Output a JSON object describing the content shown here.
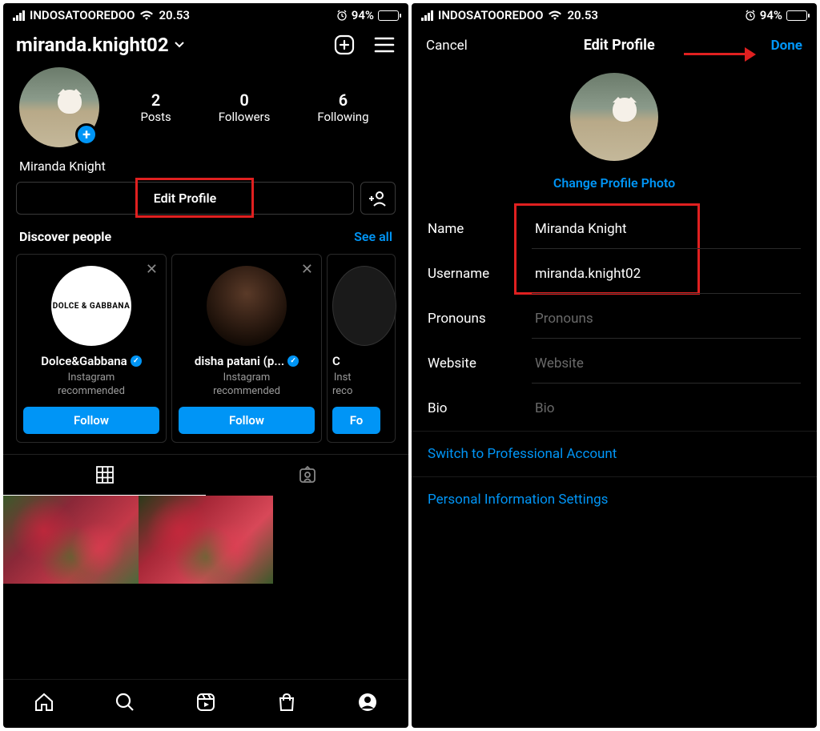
{
  "status": {
    "carrier": "INDOSATOOREDOO",
    "time": "20.53",
    "battery_pct": "94%"
  },
  "left": {
    "username_handle": "miranda.knight02",
    "stats": {
      "posts_n": "2",
      "posts_l": "Posts",
      "followers_n": "0",
      "followers_l": "Followers",
      "following_n": "6",
      "following_l": "Following"
    },
    "display_name": "Miranda Knight",
    "edit_profile_label": "Edit Profile",
    "discover_title": "Discover people",
    "see_all": "See all",
    "cards": [
      {
        "name": "Dolce&Gabbana",
        "sub1": "Instagram",
        "sub2": "recommended",
        "follow": "Follow"
      },
      {
        "name": "disha patani (p...",
        "sub1": "Instagram",
        "sub2": "recommended",
        "follow": "Follow"
      },
      {
        "name": "C",
        "sub1": "Inst",
        "sub2": "reco",
        "follow": "Fo"
      }
    ]
  },
  "right": {
    "cancel": "Cancel",
    "title": "Edit Profile",
    "done": "Done",
    "change_photo": "Change Profile Photo",
    "fields": {
      "name_l": "Name",
      "name_v": "Miranda Knight",
      "username_l": "Username",
      "username_v": "miranda.knight02",
      "pronouns_l": "Pronouns",
      "pronouns_ph": "Pronouns",
      "website_l": "Website",
      "website_ph": "Website",
      "bio_l": "Bio",
      "bio_ph": "Bio"
    },
    "switch_pro": "Switch to Professional Account",
    "personal_info": "Personal Information Settings"
  }
}
